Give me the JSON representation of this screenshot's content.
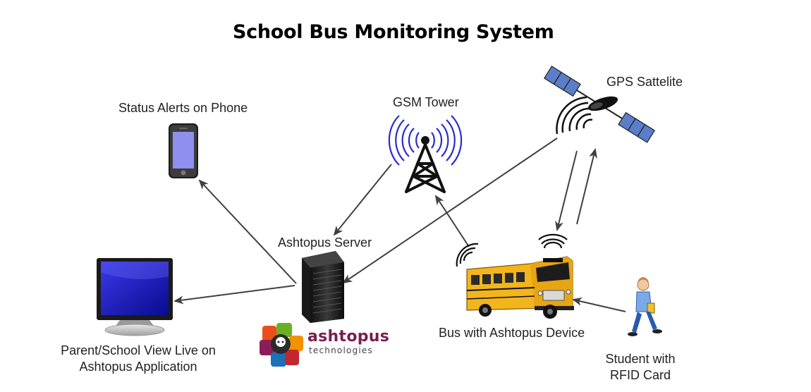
{
  "title": "School Bus Monitoring System",
  "nodes": {
    "phone": "Status Alerts on Phone",
    "gsm": "GSM Tower",
    "gps": "GPS Sattelite",
    "server": "Ashtopus Server",
    "monitor_line1": "Parent/School View Live on",
    "monitor_line2": "Ashtopus Application",
    "bus": "Bus with Ashtopus Device",
    "student_line1": "Student with",
    "student_line2": "RFID Card"
  },
  "logo": {
    "brand": "ashtopus",
    "sub": "technologies"
  },
  "colors": {
    "arrow": "#404040",
    "bus_yellow": "#f2b51c",
    "screen_blue": "#1a1ab8",
    "phone_screen": "#8f8ff0",
    "signal_blue": "#2a2ad0"
  }
}
